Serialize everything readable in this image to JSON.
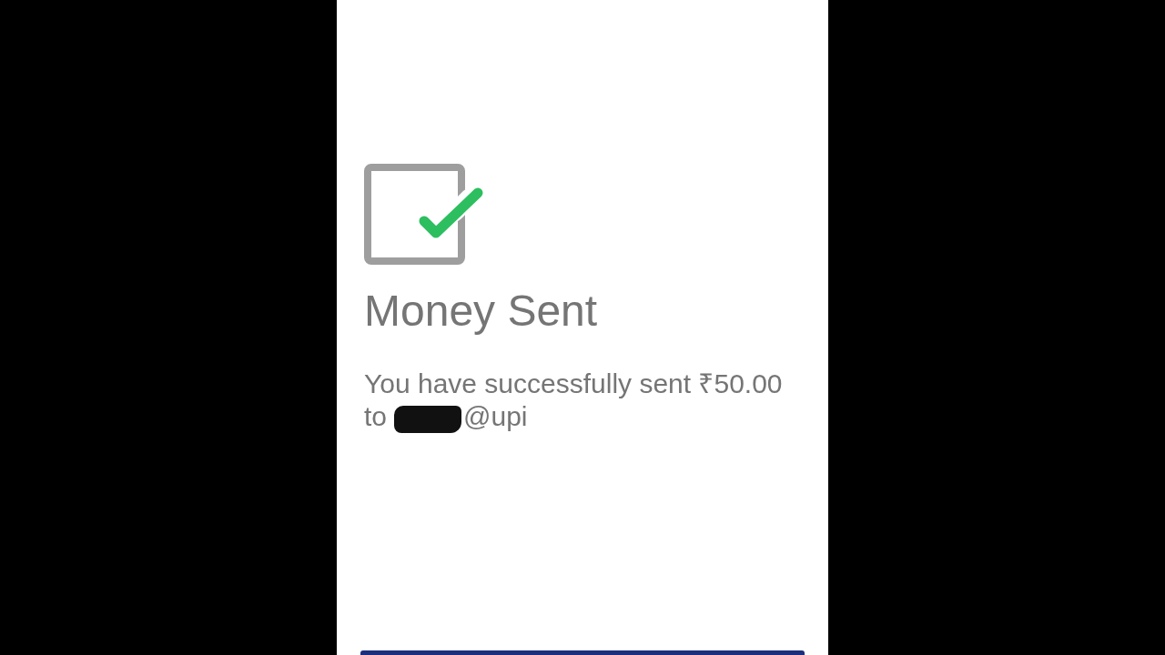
{
  "screen": {
    "title": "Money Sent",
    "message": {
      "text": "You have successfully sent ₹50.00",
      "recipient_prefix": "to",
      "recipient_redacted": true,
      "recipient_suffix": "@upi"
    }
  }
}
